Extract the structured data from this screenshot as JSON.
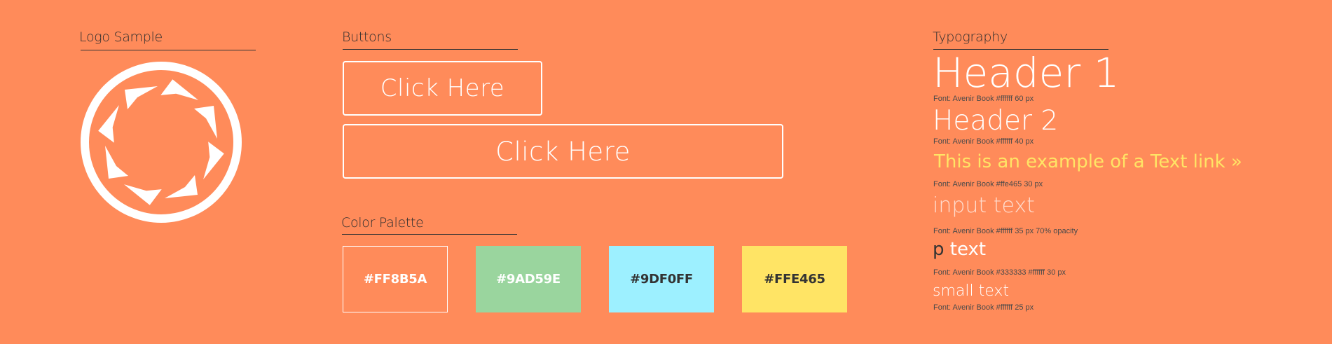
{
  "logo_section": {
    "label": "Logo Sample"
  },
  "buttons_section": {
    "label": "Buttons",
    "button_small_label": "Click Here",
    "button_large_label": "Click Here"
  },
  "palette_section": {
    "label": "Color Palette",
    "swatches": [
      {
        "hex": "#FF8B5A",
        "label": "#FF8B5A",
        "text_color": "#ffffff"
      },
      {
        "hex": "#9AD59E",
        "label": "#9AD59E",
        "text_color": "#ffffff"
      },
      {
        "hex": "#9DF0FF",
        "label": "#9DF0FF",
        "text_color": "#333333"
      },
      {
        "hex": "#FFE465",
        "label": "#FFE465",
        "text_color": "#333333"
      }
    ]
  },
  "typography_section": {
    "label": "Typography",
    "items": [
      {
        "sample": "Header 1",
        "note": "Font: Avenir Book #ffffff 60 px",
        "color": "#ffffff"
      },
      {
        "sample": "Header 2",
        "note": "Font: Avenir Book #ffffff 40 px",
        "color": "#ffffff"
      },
      {
        "sample": "This is an example of a Text link »",
        "note": "Font: Avenir Book #ffe465 30 px",
        "color": "#FFE465"
      },
      {
        "sample": "input text",
        "note": "Font: Avenir Book #ffffff 35 px 70% opacity",
        "color": "#ffffff"
      },
      {
        "sample": "p text",
        "note": "Font: Avenir Book #333333 #ffffff 30 px",
        "color": "#333333"
      },
      {
        "sample": "small text",
        "note": "Font: Avenir Book #ffffff 25 px",
        "color": "#ffffff"
      }
    ]
  }
}
